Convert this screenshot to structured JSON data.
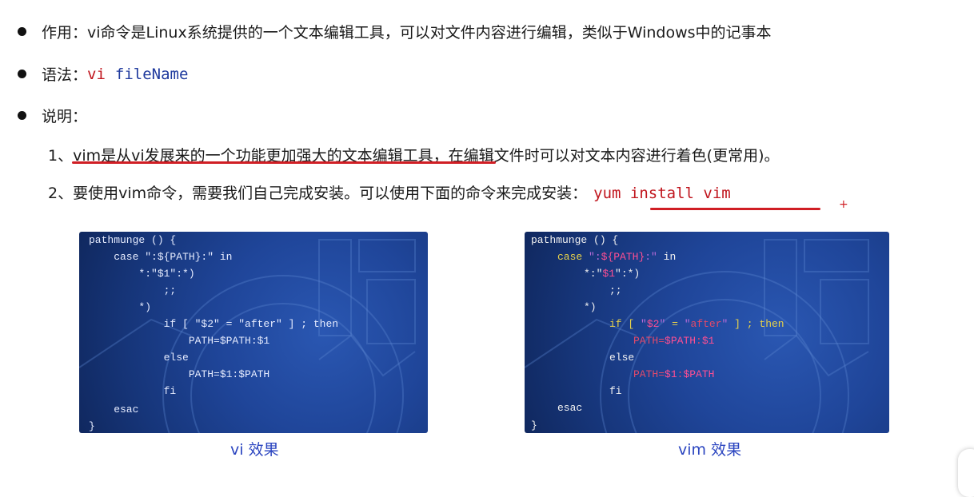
{
  "bullets": {
    "b1": {
      "text": "作用：vi命令是Linux系统提供的一个文本编辑工具，可以对文件内容进行编辑，类似于Windows中的记事本"
    },
    "b2": {
      "label": "语法：",
      "cmd": "vi",
      "arg": "fileName"
    },
    "b3": {
      "label": "说明："
    }
  },
  "notes": {
    "n1": {
      "prefix": "1、",
      "underlined": "vim是从vi发展来的一个功能更加强大的文本编辑工具，",
      "rest": "在编辑文件时可以对文本内容进行着色(更常用)。"
    },
    "n2": {
      "text": "2、要使用vim命令，需要我们自己完成安装。可以使用下面的命令来完成安装：",
      "cmd": "yum install vim"
    }
  },
  "panels": {
    "vi": {
      "caption": "vi 效果",
      "lines": [
        "pathmunge () {",
        "    case \":${PATH}:\" in",
        "        *:\"$1\":*)",
        "            ;;",
        "        *)",
        "            if [ \"$2\" = \"after\" ] ; then",
        "                PATH=$PATH:$1",
        "            else",
        "                PATH=$1:$PATH",
        "            fi",
        "    esac",
        "}"
      ]
    },
    "vim": {
      "caption": "vim 效果",
      "l0": "pathmunge () {",
      "l1a": "case",
      "l1b": "\":",
      "l1c": "${PATH}",
      "l1d": ":\"",
      "l1e": "in",
      "l2a": "*:\"",
      "l2b": "$1",
      "l2c": "\":*)",
      "l3": ";;",
      "l4": "*)",
      "l5a": "if",
      "l5b": "[",
      "l5c": "\"",
      "l5d": "$2",
      "l5e": "\"",
      "l5f": "=",
      "l5g": "\"",
      "l5h": "after",
      "l5i": "\"",
      "l5j": "] ;",
      "l5k": "then",
      "l6a": "PATH=",
      "l6b": "$PATH",
      "l6c": ":",
      "l6d": "$1",
      "l7": "else",
      "l8a": "PATH=",
      "l8b": "$1",
      "l8c": ":",
      "l8d": "$PATH",
      "l9": "fi",
      "l10": "esac",
      "l11": "}"
    }
  },
  "marks": {
    "plus": "+"
  }
}
